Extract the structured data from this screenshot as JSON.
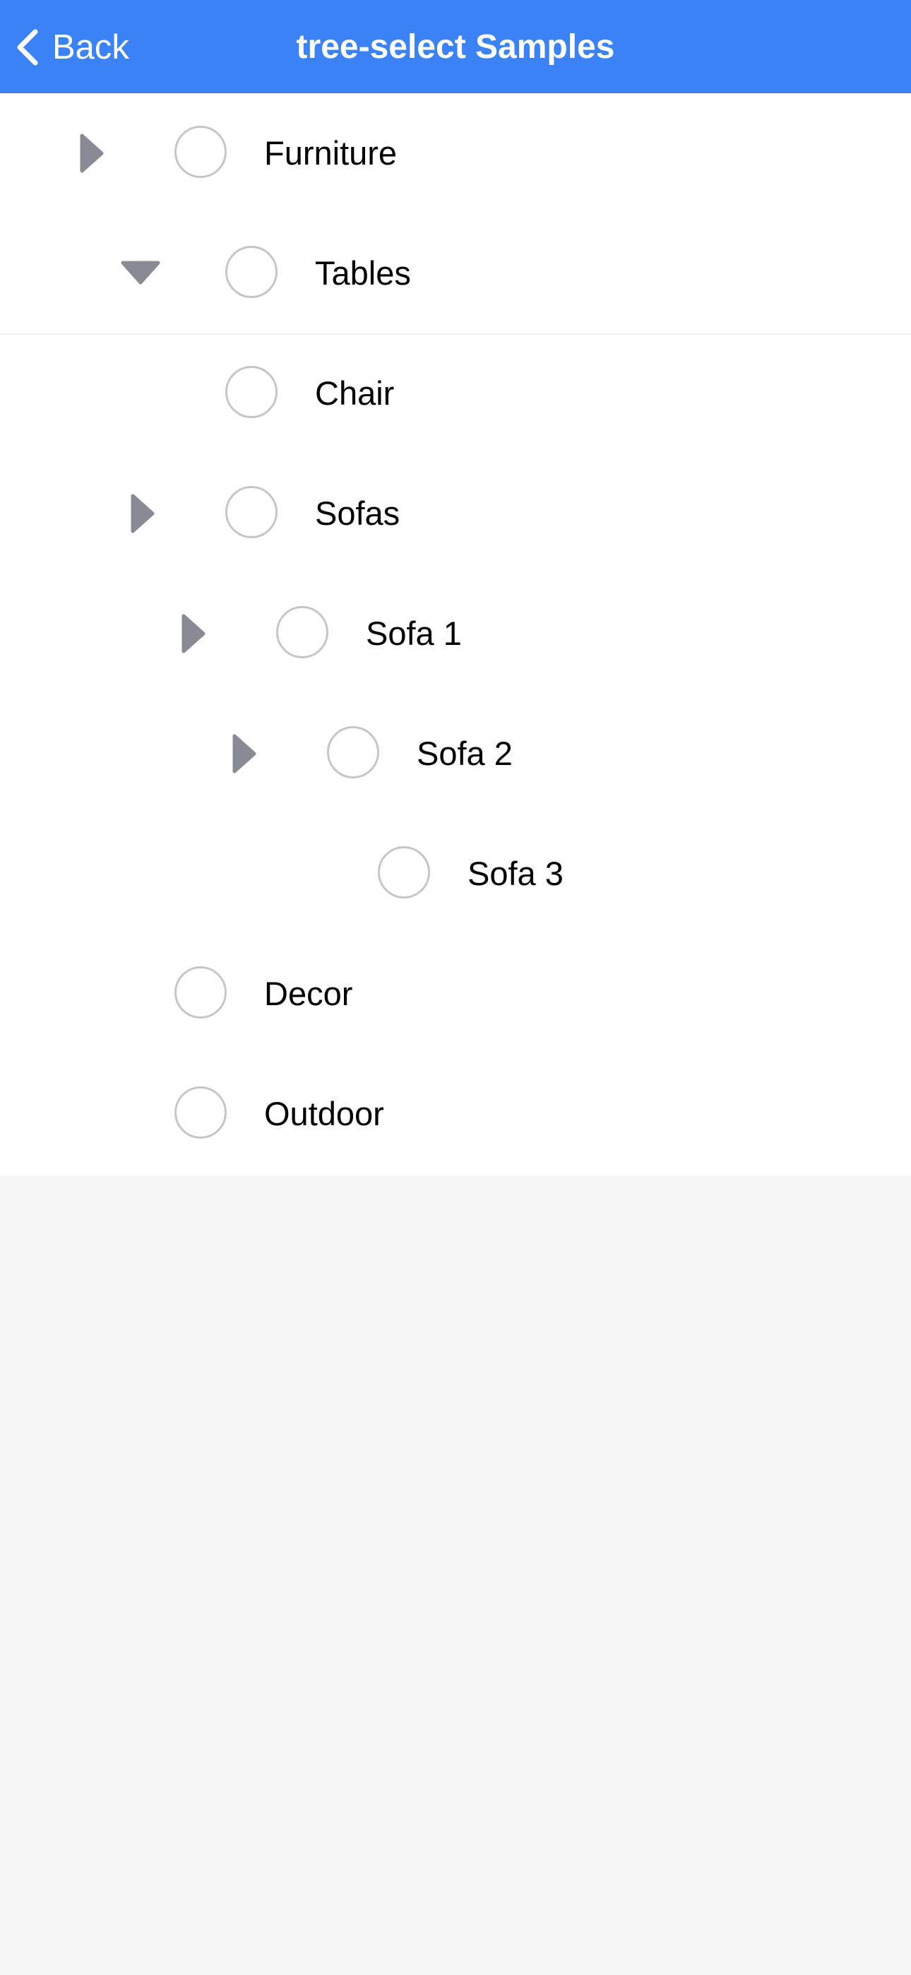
{
  "nav": {
    "back_label": "Back",
    "title": "tree-select Samples",
    "background_color": "#3b82f6"
  },
  "tree": {
    "nodes": [
      {
        "label": "Furniture",
        "level": 0,
        "toggle": "collapsed",
        "checked": false
      },
      {
        "label": "Tables",
        "level": 1,
        "toggle": "expanded",
        "checked": false
      },
      {
        "label": "Chair",
        "level": 1,
        "toggle": "none",
        "checked": false
      },
      {
        "label": "Sofas",
        "level": 1,
        "toggle": "collapsed",
        "checked": false
      },
      {
        "label": "Sofa 1",
        "level": 2,
        "toggle": "collapsed",
        "checked": false
      },
      {
        "label": "Sofa 2",
        "level": 3,
        "toggle": "collapsed",
        "checked": false
      },
      {
        "label": "Sofa 3",
        "level": 4,
        "toggle": "none",
        "checked": false
      },
      {
        "label": "Decor",
        "level": 0,
        "toggle": "none",
        "checked": false
      },
      {
        "label": "Outdoor",
        "level": 0,
        "toggle": "none",
        "checked": false
      }
    ],
    "toggle_color": "#8a8a94",
    "circle_border_color": "#c6c6c6"
  }
}
